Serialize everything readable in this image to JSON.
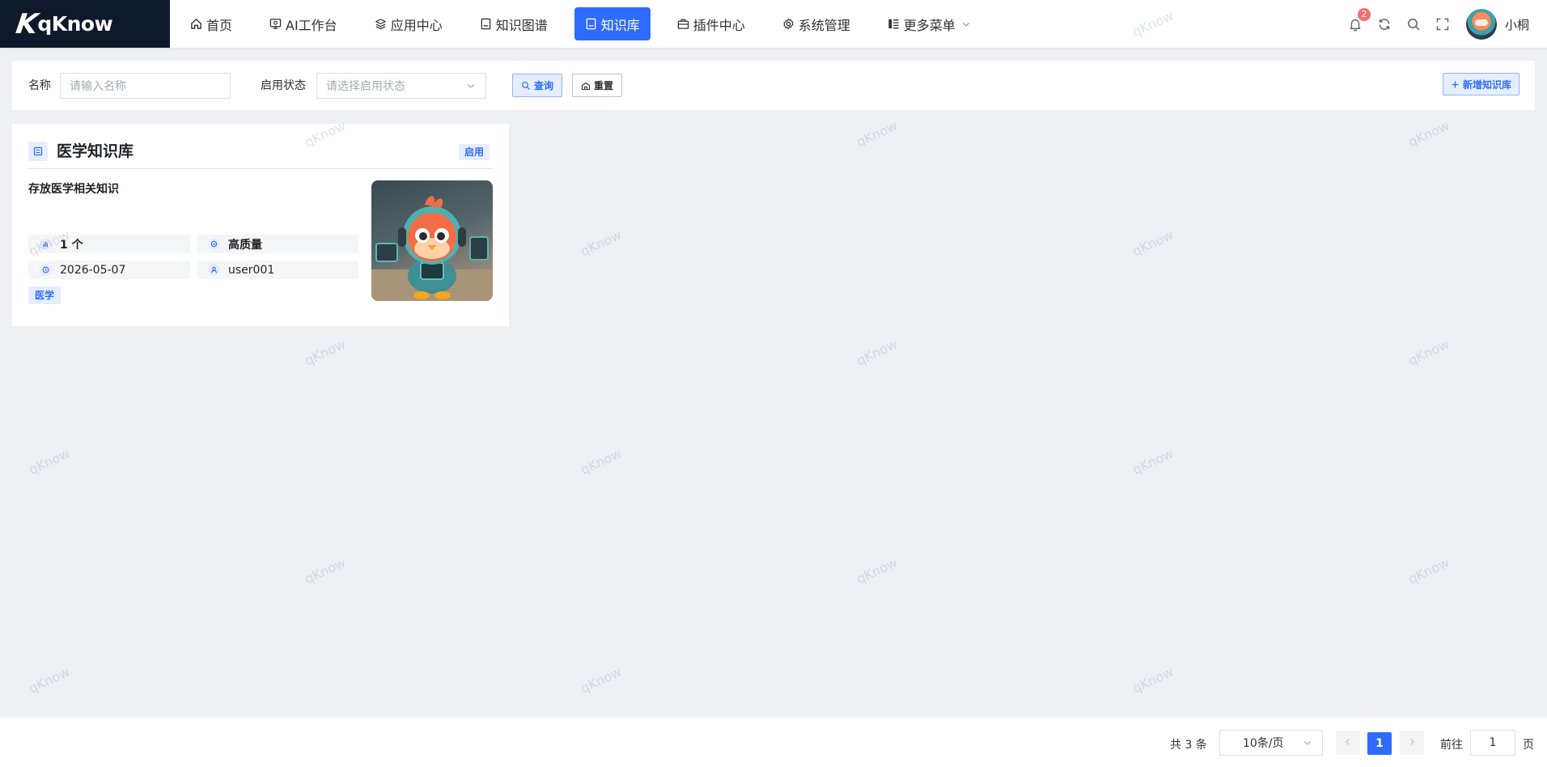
{
  "brand": {
    "logo_text": "qKnow"
  },
  "nav": {
    "items": [
      {
        "label": "首页",
        "icon": "home-icon"
      },
      {
        "label": "AI工作台",
        "icon": "monitor-icon"
      },
      {
        "label": "应用中心",
        "icon": "layers-icon"
      },
      {
        "label": "知识图谱",
        "icon": "document-icon"
      },
      {
        "label": "知识库",
        "icon": "book-icon",
        "active": true
      },
      {
        "label": "插件中心",
        "icon": "briefcase-icon"
      },
      {
        "label": "系统管理",
        "icon": "gear-icon"
      },
      {
        "label": "更多菜单",
        "icon": "menu-icon"
      }
    ]
  },
  "header_tools": {
    "notification_count": "2",
    "user_name": "小桐"
  },
  "search": {
    "name_label": "名称",
    "name_placeholder": "请输入名称",
    "status_label": "启用状态",
    "status_placeholder": "请选择启用状态",
    "query_button": "查询",
    "reset_button": "重置",
    "add_button": "新增知识库"
  },
  "cards": [
    {
      "title": "医学知识库",
      "status": "启用",
      "description": "存放医学相关知识",
      "doc_count": "1 个",
      "quality": "高质量",
      "date": "2026-05-07",
      "owner": "user001",
      "tag": "医学"
    }
  ],
  "watermark": "qKnow",
  "pagination": {
    "total": "共 3 条",
    "page_size": "10条/页",
    "current_page": "1",
    "goto_label": "前往",
    "goto_value": "1",
    "goto_unit": "页"
  },
  "colors": {
    "primary": "#2f6bff",
    "logo_bg": "#0e1a2b",
    "page_bg": "#eef0f4",
    "badge": "#f56c6c"
  }
}
